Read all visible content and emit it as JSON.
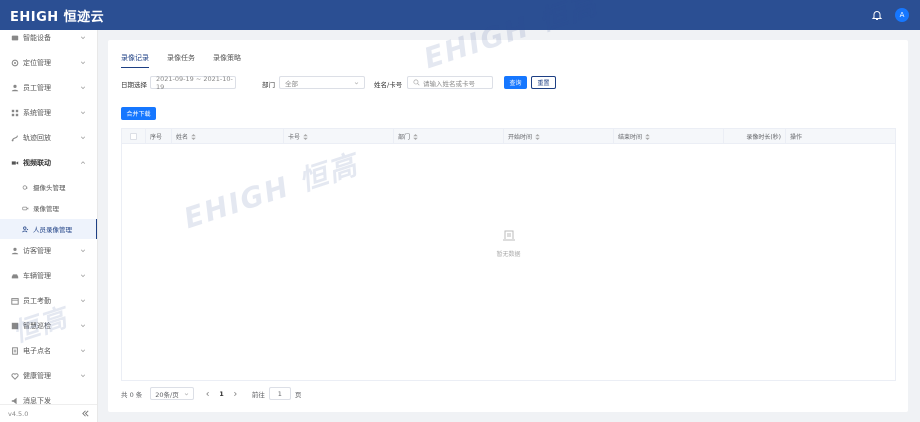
{
  "header": {
    "logo": "EHIGH 恒迹云",
    "avatar_initial": "A"
  },
  "sidebar": {
    "items": [
      {
        "label": "智能设备",
        "icon": "device-icon"
      },
      {
        "label": "定位管理",
        "icon": "location-icon"
      },
      {
        "label": "员工管理",
        "icon": "user-icon"
      },
      {
        "label": "系统管理",
        "icon": "grid-icon"
      },
      {
        "label": "轨迹回放",
        "icon": "track-icon"
      },
      {
        "label": "视频联动",
        "icon": "video-icon",
        "open": true
      },
      {
        "label": "访客管理",
        "icon": "visitor-icon"
      },
      {
        "label": "车辆管理",
        "icon": "car-icon"
      },
      {
        "label": "员工考勤",
        "icon": "attendance-icon"
      },
      {
        "label": "智慧巡检",
        "icon": "inspection-icon"
      },
      {
        "label": "电子点名",
        "icon": "rollcall-icon"
      },
      {
        "label": "健康管理",
        "icon": "health-icon"
      },
      {
        "label": "消息下发",
        "icon": "message-icon"
      }
    ],
    "sub_items": [
      {
        "label": "摄像头管理",
        "icon": "camera-icon"
      },
      {
        "label": "录像管理",
        "icon": "recording-icon"
      },
      {
        "label": "人员录像管理",
        "icon": "person-video-icon",
        "active": true
      }
    ],
    "version": "v4.5.0"
  },
  "tabs": [
    {
      "label": "录像记录",
      "active": true
    },
    {
      "label": "录像任务"
    },
    {
      "label": "录像策略"
    }
  ],
  "filters": {
    "date_label": "日期选择",
    "date_range": "2021-09-19 ~ 2021-10-19",
    "dept_label": "部门",
    "dept_value": "全部",
    "name_label": "姓名/卡号",
    "name_placeholder": "请输入姓名或卡号",
    "query_label": "查询",
    "reset_label": "重置"
  },
  "merge_download_label": "合并下载",
  "table": {
    "columns": [
      "序号",
      "姓名",
      "卡号",
      "部门",
      "开始时间",
      "结束时间",
      "录像时长(秒)",
      "操作"
    ],
    "empty_text": "暂无数据"
  },
  "pagination": {
    "total": "共 0 条",
    "page_size": "20条/页",
    "current_page": "1",
    "goto_label": "前往",
    "goto_value": "1",
    "page_suffix": "页"
  },
  "watermark": {
    "text_1": "EHIGH 恒高",
    "text_2": "EHIGH 恒高",
    "text_3": "恒高"
  },
  "colors": {
    "header_bg": "#2b4f93",
    "primary": "#1677ff",
    "active_nav": "#1d3f84"
  }
}
